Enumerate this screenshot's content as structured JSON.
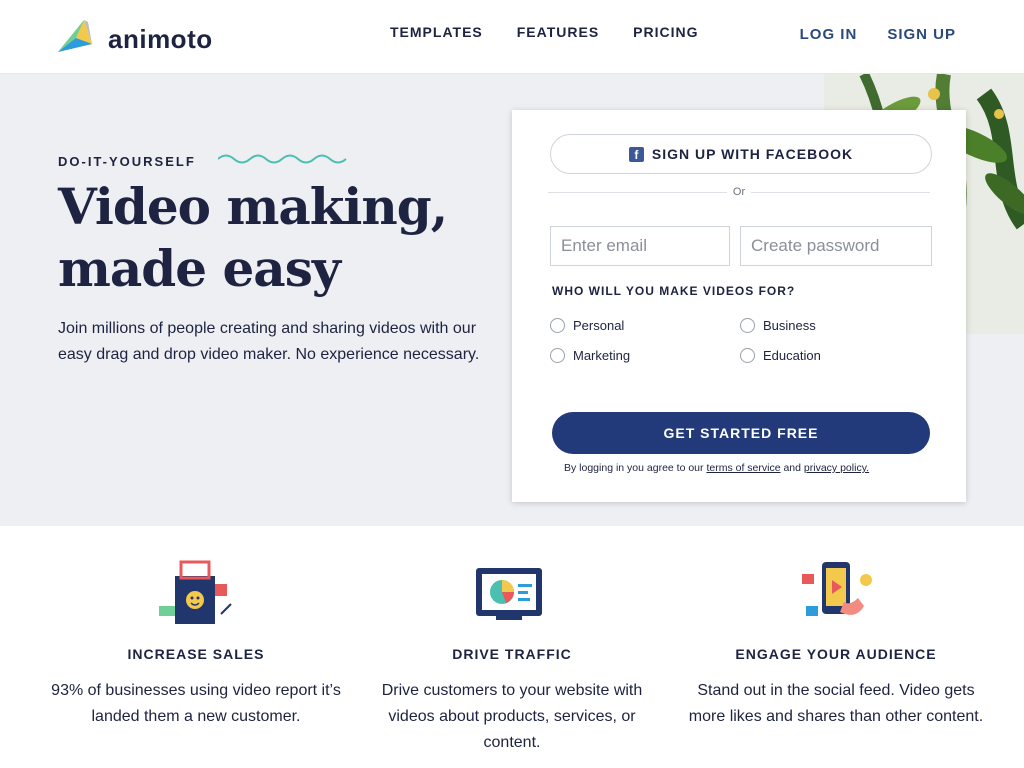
{
  "header": {
    "brand": "animoto",
    "nav": [
      "TEMPLATES",
      "FEATURES",
      "PRICING"
    ],
    "login": "LOG IN",
    "signup": "SIGN UP"
  },
  "hero": {
    "eyebrow": "DO-IT-YOURSELF",
    "headline": "Video making, made easy",
    "subtext": "Join millions of people creating and sharing videos with our easy drag and drop video maker. No experience necessary."
  },
  "signup_card": {
    "facebook_label": "SIGN UP WITH FACEBOOK",
    "or_label": "Or",
    "email_placeholder": "Enter email",
    "password_placeholder": "Create password",
    "question": "WHO WILL YOU MAKE VIDEOS FOR?",
    "options": [
      "Personal",
      "Business",
      "Marketing",
      "Education"
    ],
    "cta": "GET STARTED FREE",
    "legal_prefix": "By logging in you agree to our",
    "terms_link": "terms of service",
    "legal_and": "and",
    "privacy_link": "privacy policy."
  },
  "features": [
    {
      "title": "INCREASE SALES",
      "desc": "93% of businesses using video report it’s landed them a new customer.",
      "icon": "shopping-bag-icon"
    },
    {
      "title": "DRIVE TRAFFIC",
      "desc": "Drive customers to your website with videos about products, services, or content.",
      "icon": "analytics-screen-icon"
    },
    {
      "title": "ENGAGE YOUR AUDIENCE",
      "desc": "Stand out in the social feed. Video gets more likes and shares than other content.",
      "icon": "phone-social-icon"
    }
  ],
  "colors": {
    "navy": "#1d2340",
    "cta": "#223a79",
    "hero_bg": "#eeeff3",
    "facebook": "#3b5998"
  }
}
